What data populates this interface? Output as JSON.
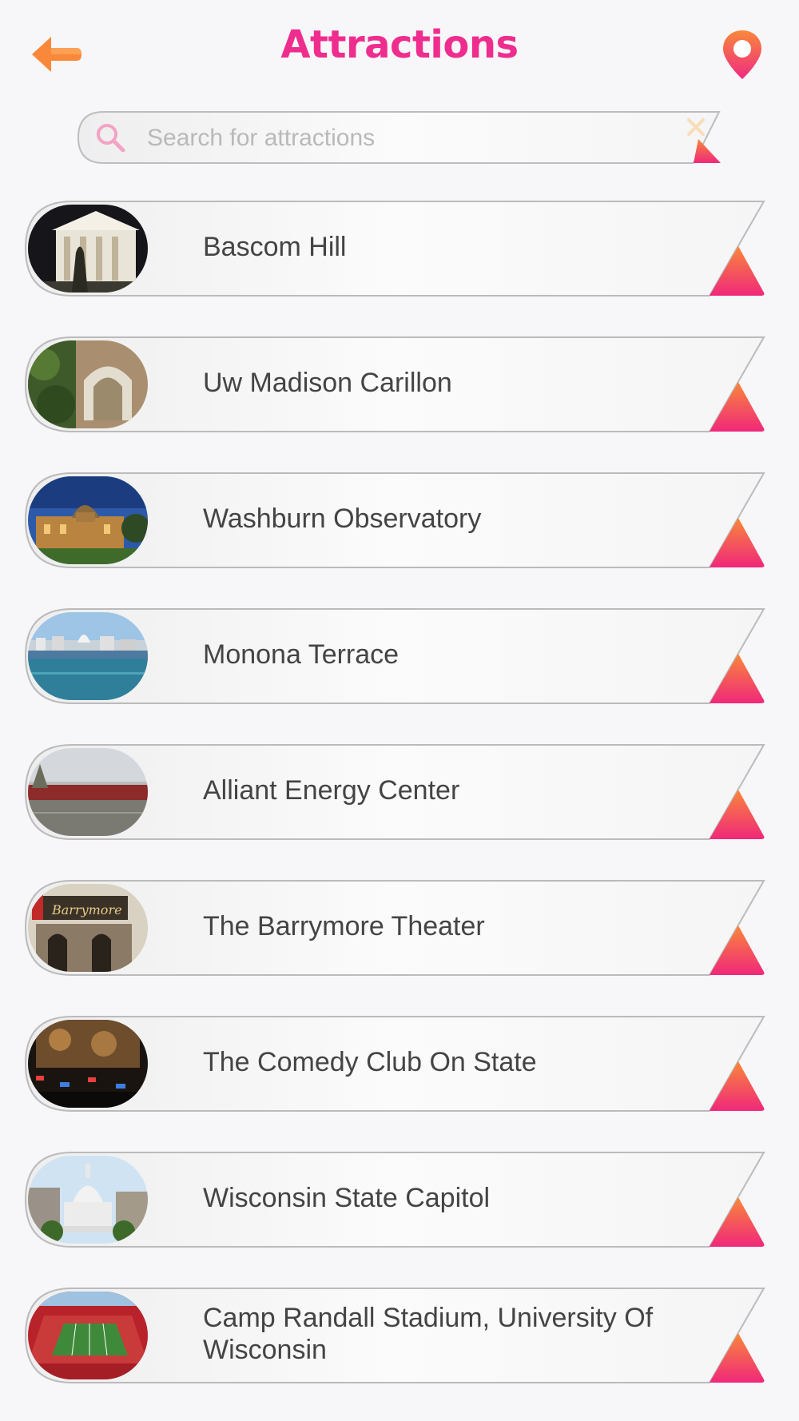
{
  "header": {
    "title": "Attractions",
    "back_icon": "back-arrow-icon",
    "map_icon": "map-pin-icon"
  },
  "search": {
    "placeholder": "Search for attractions",
    "value": "",
    "search_icon": "search-icon",
    "clear_icon": "close-icon"
  },
  "attractions": [
    {
      "name": "Bascom Hill",
      "thumbnail": "bascom-hill-photo"
    },
    {
      "name": "Uw Madison Carillon",
      "thumbnail": "carillon-photo"
    },
    {
      "name": "Washburn Observatory",
      "thumbnail": "observatory-photo"
    },
    {
      "name": "Monona Terrace",
      "thumbnail": "monona-terrace-photo"
    },
    {
      "name": "Alliant Energy Center",
      "thumbnail": "alliant-energy-center-photo"
    },
    {
      "name": "The Barrymore Theater",
      "thumbnail": "barrymore-theater-photo"
    },
    {
      "name": "The Comedy Club On State",
      "thumbnail": "comedy-club-photo"
    },
    {
      "name": "Wisconsin State Capitol",
      "thumbnail": "state-capitol-photo"
    },
    {
      "name": "Camp Randall Stadium, University Of Wisconsin",
      "thumbnail": "camp-randall-stadium-photo"
    }
  ],
  "colors": {
    "accent_pink": "#ee2d8e",
    "accent_orange": "#f9883a",
    "background": "#f7f6f8",
    "text": "#444444"
  }
}
